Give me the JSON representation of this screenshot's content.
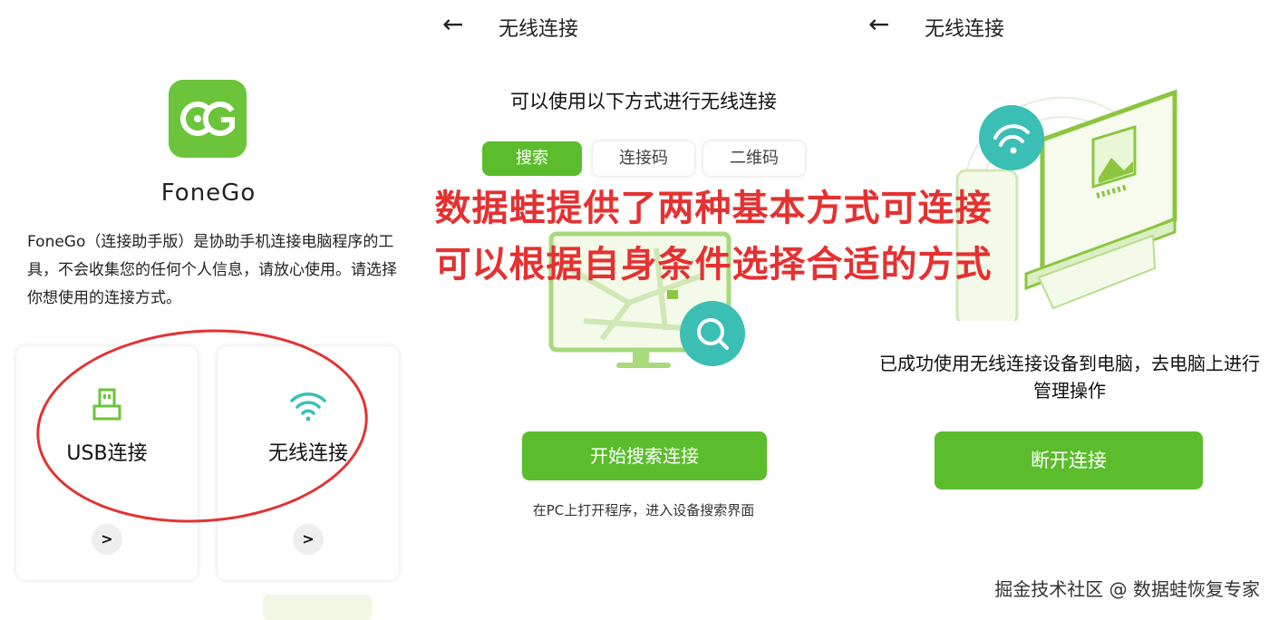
{
  "left_panel": {
    "app_name": "FoneGo",
    "description": "FoneGo（连接助手版）是协助手机连接电脑程序的工具，不会收集您的任何个人信息，请放心使用。请选择你想使用的连接方式。",
    "options": [
      {
        "label": "USB连接",
        "icon": "usb-icon"
      },
      {
        "label": "无线连接",
        "icon": "wifi-icon"
      }
    ]
  },
  "middle_panel": {
    "title": "无线连接",
    "subtitle": "可以使用以下方式进行无线连接",
    "tabs": [
      {
        "label": "搜索",
        "active": true
      },
      {
        "label": "连接码",
        "active": false
      },
      {
        "label": "二维码",
        "active": false
      }
    ],
    "button": "开始搜索连接",
    "hint": "在PC上打开程序，进入设备搜索界面"
  },
  "right_panel": {
    "title": "无线连接",
    "message": "已成功使用无线连接设备到电脑，去电脑上进行管理操作",
    "button": "断开连接"
  },
  "overlay": {
    "line1": "数据蛙提供了两种基本方式可连接",
    "line2": "可以根据自身条件选择合适的方式"
  },
  "watermark": "掘金技术社区 @ 数据蛙恢复专家",
  "colors": {
    "accent_green": "#5bbd2c",
    "logo_green": "#6bc43a",
    "annotation_red": "#e53131",
    "teal": "#3bbfb4"
  }
}
